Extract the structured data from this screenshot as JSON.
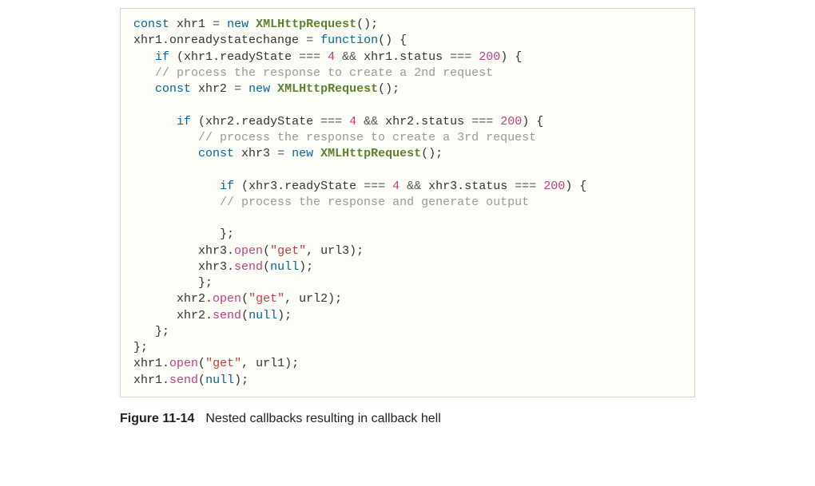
{
  "code": {
    "l1": {
      "kw_const": "const",
      "id": "xhr1",
      "op_eq": "=",
      "kw_new": "new",
      "cls": "XMLHttpRequest",
      "after": "();"
    },
    "l2": {
      "id": "xhr1",
      "prop": "onreadystatechange",
      "op_eq": "=",
      "kw_fn": "function",
      "after": "() {"
    },
    "l3": {
      "indent": "   ",
      "kw_if": "if",
      "open": " (",
      "a": "xhr1",
      "dot1": ".",
      "b": "readyState",
      "op1": " === ",
      "n1": "4",
      "and": " && ",
      "c": "xhr1",
      "dot2": ".",
      "d": "status",
      "op2": " === ",
      "n2": "200",
      "close": ") {"
    },
    "l4": {
      "indent": "   ",
      "comment": "// process the response to create a 2nd request"
    },
    "l5": {
      "indent": "   ",
      "kw_const": "const",
      "id": "xhr2",
      "op_eq": "=",
      "kw_new": "new",
      "cls": "XMLHttpRequest",
      "after": "();"
    },
    "l6": "",
    "l7": {
      "indent": "      ",
      "kw_if": "if",
      "open": " (",
      "a": "xhr2",
      "dot1": ".",
      "b": "readyState",
      "op1": " === ",
      "n1": "4",
      "and": " && ",
      "c": "xhr2",
      "dot2": ".",
      "d": "status",
      "op2": " === ",
      "n2": "200",
      "close": ") {"
    },
    "l8": {
      "indent": "         ",
      "comment": "// process the response to create a 3rd request"
    },
    "l9": {
      "indent": "         ",
      "kw_const": "const",
      "id": "xhr3",
      "op_eq": "=",
      "kw_new": "new",
      "cls": "XMLHttpRequest",
      "after": "();"
    },
    "l10": "",
    "l11": {
      "indent": "            ",
      "kw_if": "if",
      "open": " (",
      "a": "xhr3",
      "dot1": ".",
      "b": "readyState",
      "op1": " === ",
      "n1": "4",
      "and": " && ",
      "c": "xhr3",
      "dot2": ".",
      "d": "status",
      "op2": " === ",
      "n2": "200",
      "close": ") {"
    },
    "l12": {
      "indent": "            ",
      "comment": "// process the response and generate output"
    },
    "l13": "",
    "l14": {
      "indent": "            ",
      "text": "};"
    },
    "l15": {
      "indent": "         ",
      "obj": "xhr3",
      "dot": ".",
      "fn": "open",
      "open": "(",
      "str": "\"get\"",
      "comma": ", ",
      "arg": "url3",
      "close": ");"
    },
    "l16": {
      "indent": "         ",
      "obj": "xhr3",
      "dot": ".",
      "fn": "send",
      "open": "(",
      "nl": "null",
      "close": ");"
    },
    "l17": {
      "indent": "         ",
      "text": "};"
    },
    "l18": {
      "indent": "      ",
      "obj": "xhr2",
      "dot": ".",
      "fn": "open",
      "open": "(",
      "str": "\"get\"",
      "comma": ", ",
      "arg": "url2",
      "close": ");"
    },
    "l19": {
      "indent": "      ",
      "obj": "xhr2",
      "dot": ".",
      "fn": "send",
      "open": "(",
      "nl": "null",
      "close": ");"
    },
    "l20": {
      "indent": "   ",
      "text": "};"
    },
    "l21": {
      "indent": "",
      "text": "};"
    },
    "l22": {
      "indent": "",
      "obj": "xhr1",
      "dot": ".",
      "fn": "open",
      "open": "(",
      "str": "\"get\"",
      "comma": ", ",
      "arg": "url1",
      "close": ");"
    },
    "l23": {
      "indent": "",
      "obj": "xhr1",
      "dot": ".",
      "fn": "send",
      "open": "(",
      "nl": "null",
      "close": ");"
    }
  },
  "caption": {
    "label": "Figure 11-14",
    "text": "Nested callbacks resulting in callback hell"
  }
}
